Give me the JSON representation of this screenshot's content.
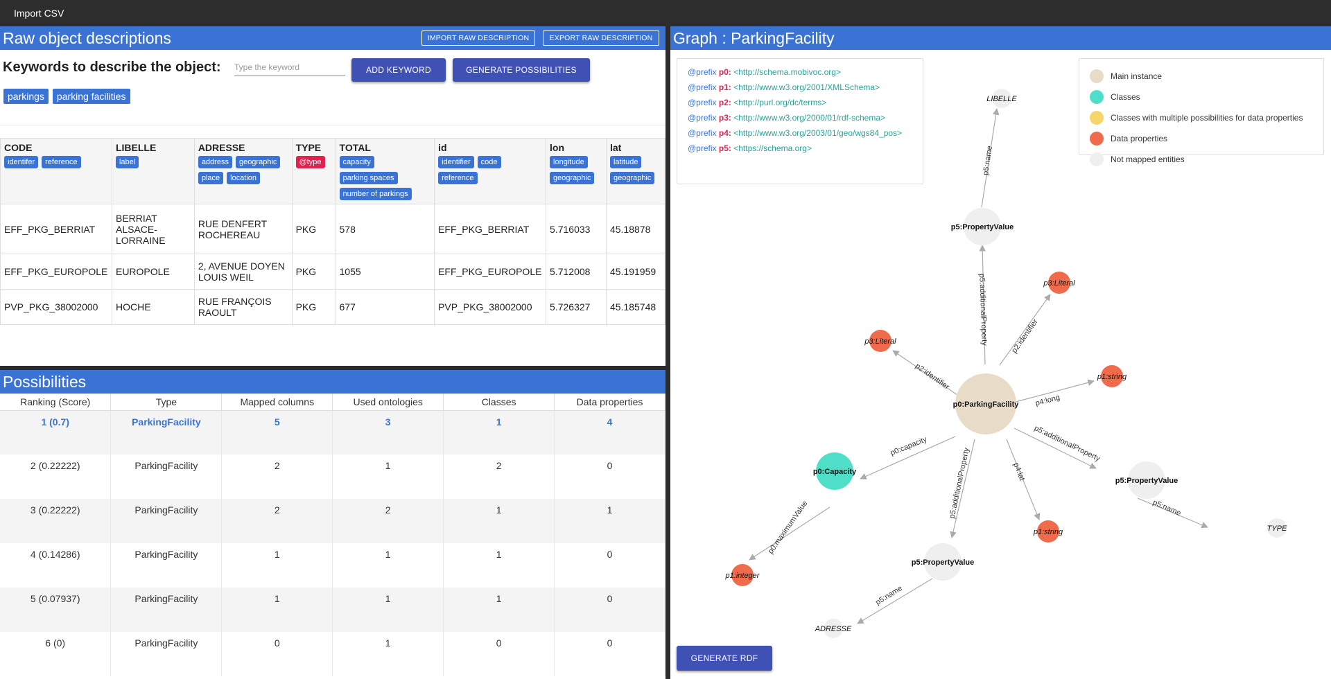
{
  "topbar": {
    "title": "Import CSV"
  },
  "raw": {
    "title": "Raw object descriptions",
    "import_btn": "IMPORT RAW DESCRIPTION",
    "export_btn": "EXPORT RAW DESCRIPTION",
    "keywords_label": "Keywords to describe the object:",
    "keyword_placeholder": "Type the keyword",
    "add_keyword": "ADD KEYWORD",
    "generate": "GENERATE POSSIBILITIES",
    "chips": [
      "parkings",
      "parking facilities"
    ],
    "columns": [
      {
        "name": "CODE",
        "tags": [
          "identifer",
          "reference"
        ]
      },
      {
        "name": "LIBELLE",
        "tags": [
          "label"
        ]
      },
      {
        "name": "ADRESSE",
        "tags": [
          "address",
          "geographic",
          "place",
          "location"
        ]
      },
      {
        "name": "TYPE",
        "tags": [
          "@type"
        ]
      },
      {
        "name": "TOTAL",
        "tags": [
          "capacity",
          "parking spaces",
          "number of parkings"
        ]
      },
      {
        "name": "id",
        "tags": [
          "identifier",
          "code",
          "reference"
        ]
      },
      {
        "name": "lon",
        "tags": [
          "longitude",
          "geographic"
        ]
      },
      {
        "name": "lat",
        "tags": [
          "latitude",
          "geographic"
        ]
      }
    ],
    "rows": [
      [
        "EFF_PKG_BERRIAT",
        "BERRIAT ALSACE-LORRAINE",
        "RUE DENFERT ROCHEREAU",
        "PKG",
        "578",
        "EFF_PKG_BERRIAT",
        "5.716033",
        "45.18878"
      ],
      [
        "EFF_PKG_EUROPOLE",
        "EUROPOLE",
        "2, AVENUE DOYEN LOUIS WEIL",
        "PKG",
        "1055",
        "EFF_PKG_EUROPOLE",
        "5.712008",
        "45.191959"
      ],
      [
        "PVP_PKG_38002000",
        "HOCHE",
        "RUE FRANÇOIS RAOULT",
        "PKG",
        "677",
        "PVP_PKG_38002000",
        "5.726327",
        "45.185748"
      ]
    ]
  },
  "possibilities": {
    "title": "Possibilities",
    "headers": [
      "Ranking (Score)",
      "Type",
      "Mapped columns",
      "Used ontologies",
      "Classes",
      "Data properties"
    ],
    "rows": [
      [
        "1 (0.7)",
        "ParkingFacility",
        "5",
        "3",
        "1",
        "4"
      ],
      [
        "2 (0.22222)",
        "ParkingFacility",
        "2",
        "1",
        "2",
        "0"
      ],
      [
        "3 (0.22222)",
        "ParkingFacility",
        "2",
        "2",
        "1",
        "1"
      ],
      [
        "4 (0.14286)",
        "ParkingFacility",
        "1",
        "1",
        "1",
        "0"
      ],
      [
        "5 (0.07937)",
        "ParkingFacility",
        "1",
        "1",
        "1",
        "0"
      ],
      [
        "6 (0)",
        "ParkingFacility",
        "0",
        "1",
        "0",
        "0"
      ]
    ]
  },
  "graph": {
    "title": "Graph : ParkingFacility",
    "prefixes": [
      {
        "kw": "@prefix",
        "p": "p0:",
        "uri": "<http://schema.mobivoc.org>"
      },
      {
        "kw": "@prefix",
        "p": "p1:",
        "uri": "<http://www.w3.org/2001/XMLSchema>"
      },
      {
        "kw": "@prefix",
        "p": "p2:",
        "uri": "<http://purl.org/dc/terms>"
      },
      {
        "kw": "@prefix",
        "p": "p3:",
        "uri": "<http://www.w3.org/2000/01/rdf-schema>"
      },
      {
        "kw": "@prefix",
        "p": "p4:",
        "uri": "<http://www.w3.org/2003/01/geo/wgs84_pos>"
      },
      {
        "kw": "@prefix",
        "p": "p5:",
        "uri": "<https://schema.org>"
      }
    ],
    "legend": [
      {
        "label": "Main instance",
        "color": "#e8dcc8"
      },
      {
        "label": "Classes",
        "color": "#4fdfc8"
      },
      {
        "label": "Classes with multiple possibilities for data properties",
        "color": "#f7d56b"
      },
      {
        "label": "Data properties",
        "color": "#ef6b4b"
      },
      {
        "label": "Not mapped entities",
        "color": "#efefef"
      }
    ],
    "generate_rdf": "GENERATE RDF",
    "nodes": {
      "main": "p0:ParkingFacility",
      "capacity": "p0:Capacity",
      "pv_top": "p5:PropertyValue",
      "pv_right": "p5:PropertyValue",
      "pv_bottom": "p5:PropertyValue",
      "lit_left": "p3:Literal",
      "lit_right": "p3:Literal",
      "str_long": "p1:string",
      "str_lat": "p1:string",
      "integer": "p1:integer",
      "libelle": "LIBELLE",
      "type": "TYPE",
      "adresse": "ADRESSE"
    },
    "edges": {
      "main_pv_top": "p5:additionalProperty",
      "pv_top_libelle": "p5:name",
      "main_lit_left": "p2:identifier",
      "main_lit_right": "p2:identifier",
      "main_long": "p4:long",
      "main_pv_right": "p5:additionalProperty",
      "pv_right_type": "p5:name",
      "main_lat": "p4:lat",
      "main_pv_bottom": "p5:additionalProperty",
      "pv_bottom_adresse": "p5:name",
      "main_capacity": "p0:capacity",
      "capacity_integer": "p0:maximumValue"
    }
  }
}
